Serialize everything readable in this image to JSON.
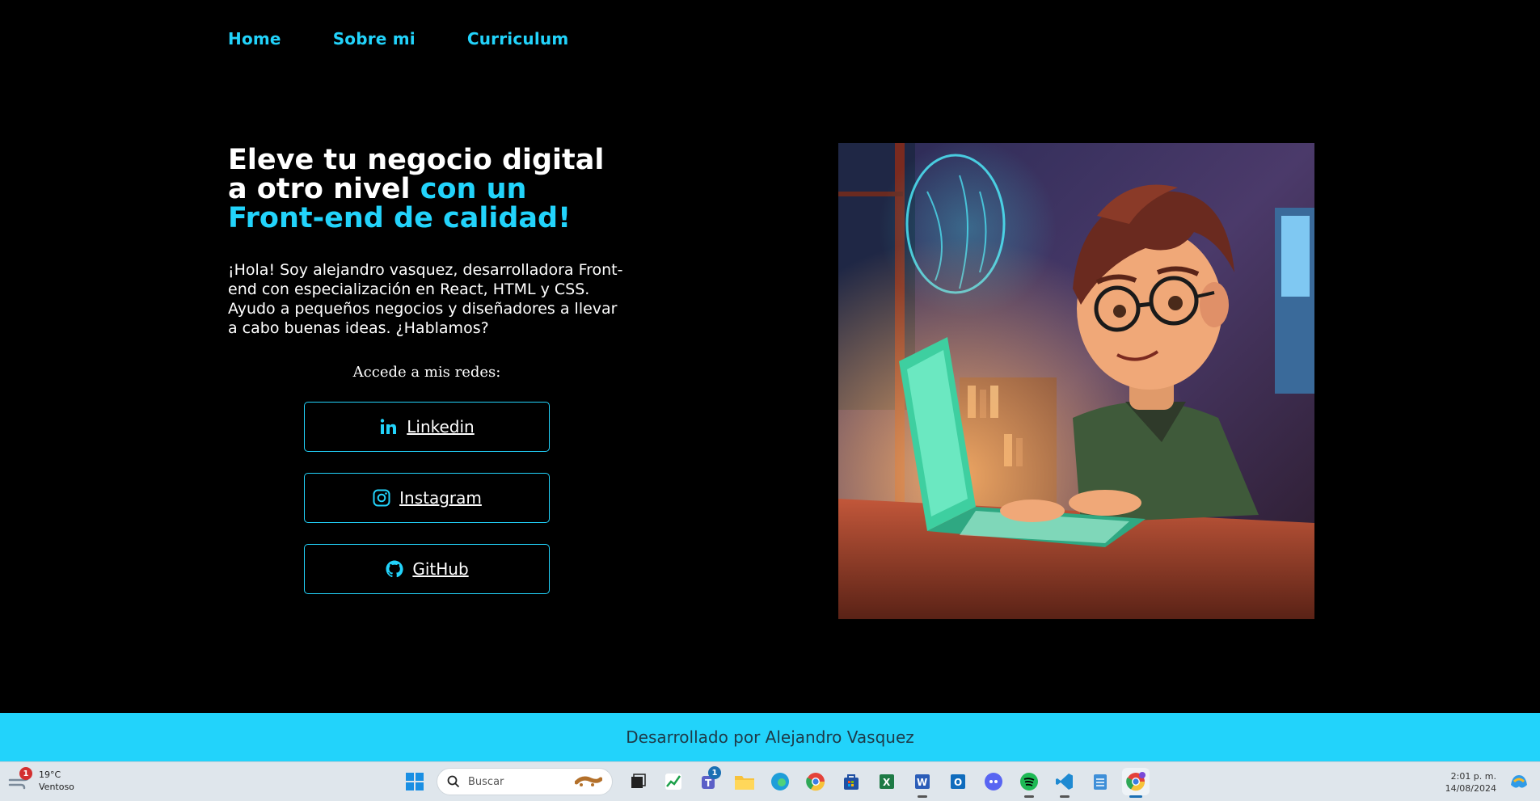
{
  "nav": {
    "home": "Home",
    "about": "Sobre mi",
    "cv": "Curriculum"
  },
  "hero": {
    "title_part1": "Eleve tu negocio digital a otro nivel ",
    "title_accent": "con un Front-end de calidad!",
    "text": "¡Hola! Soy alejandro vasquez, desarrolladora Front-end con especialización en React, HTML y CSS. Ayudo a pequeños negocios y diseñadores a llevar a cabo buenas ideas. ¿Hablamos?",
    "redes_label": "Accede a mis redes:",
    "social": {
      "linkedin": "Linkedin",
      "instagram": "Instagram",
      "github": "GitHub"
    }
  },
  "footer": {
    "text": "Desarrollado por Alejandro Vasquez"
  },
  "taskbar": {
    "weather_temp": "19°C",
    "weather_desc": "Ventoso",
    "weather_badge": "1",
    "search_placeholder": "Buscar",
    "teams_badge": "1",
    "time": "2:01 p. m.",
    "date": "14/08/2024"
  },
  "colors": {
    "accent": "#22d3fb",
    "background": "#000000",
    "footer_text": "#1e3a48"
  }
}
